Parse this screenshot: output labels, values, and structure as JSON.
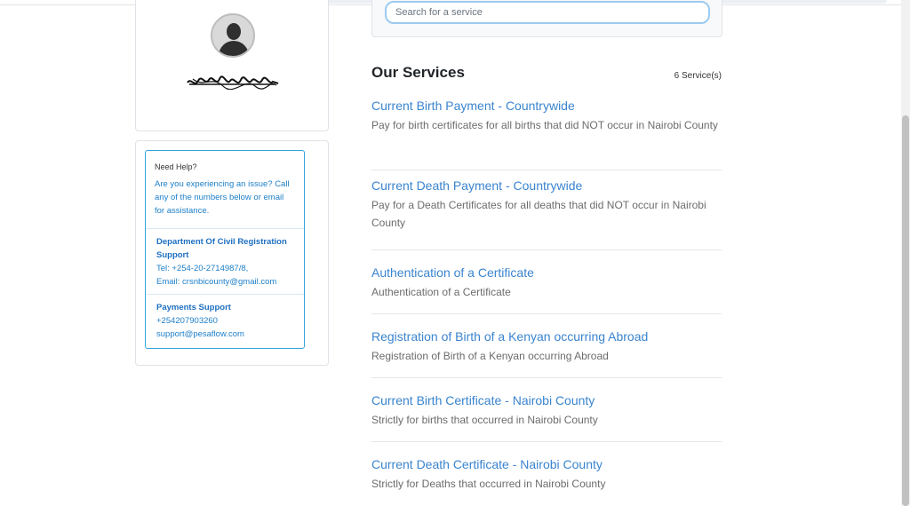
{
  "search": {
    "placeholder": "Search for a service"
  },
  "profile": {
    "avatar_icon": "user-avatar-icon",
    "name_redacted": "redacted-name-scribble"
  },
  "help": {
    "title": "Need Help?",
    "text": "Are you experiencing an issue? Call any of the numbers below or email for assistance.",
    "dept_title": "Department Of Civil Registration Support",
    "dept_tel": "Tel: +254-20-2714987/8,",
    "dept_email": "Email: crsnbicounty@gmail.com",
    "pay_title": "Payments Support",
    "pay_phone": "+254207903260",
    "pay_email": "support@pesaflow.com"
  },
  "services": {
    "title": "Our Services",
    "count": "6 Service(s)",
    "items": [
      {
        "label": "Current Birth Payment - Countrywide",
        "desc": "Pay for birth certificates for all births that did NOT occur in Nairobi County"
      },
      {
        "label": "Current Death Payment - Countrywide",
        "desc": "Pay for a Death Certificates for all deaths that did NOT occur in Nairobi County"
      },
      {
        "label": "Authentication of a Certificate",
        "desc": "Authentication of a Certificate"
      },
      {
        "label": "Registration of Birth of a Kenyan occurring Abroad",
        "desc": "Registration of Birth of a Kenyan occurring Abroad"
      },
      {
        "label": "Current Birth Certificate - Nairobi County",
        "desc": "Strictly for births that occurred in Nairobi County"
      },
      {
        "label": "Current Death Certificate - Nairobi County",
        "desc": "Strictly for Deaths that occurred in Nairobi County"
      }
    ]
  },
  "colors": {
    "link": "#3a84cf",
    "help_border": "#33a5dd",
    "help_text": "#1d7fc8"
  }
}
